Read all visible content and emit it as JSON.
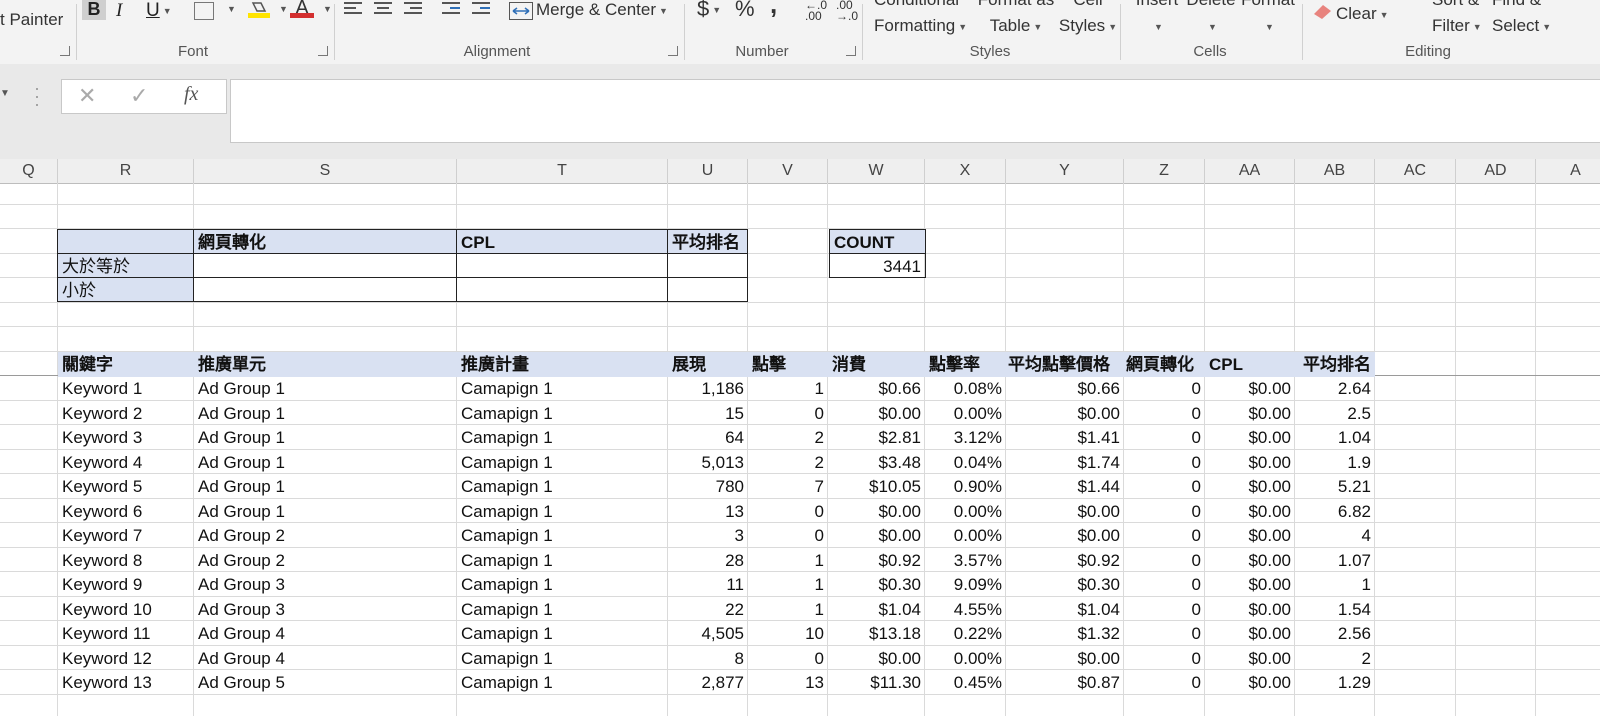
{
  "ribbon": {
    "format_painter": "t Painter",
    "merge_center": "Merge & Center",
    "currency_symbol": "$",
    "percent_symbol": "%",
    "comma_symbol": ",",
    "conditional_1": "Conditional",
    "conditional_2": "Formatting",
    "format_as_1": "Format as",
    "format_as_2": "Table",
    "cell_styles_1": "Cell",
    "cell_styles_2": "Styles",
    "insert": "Insert",
    "delete": "Delete",
    "format": "Format",
    "clear": "Clear",
    "sort_filter_1": "Sort &",
    "sort_filter_2": "Filter",
    "find_select_1": "Find &",
    "find_select_2": "Select",
    "groups": {
      "font": "Font",
      "alignment": "Alignment",
      "number": "Number",
      "styles": "Styles",
      "cells": "Cells",
      "editing": "Editing"
    },
    "colors": {
      "highlight": "#ffe400",
      "font_color": "#d32f2f",
      "clear_eraser": "#e8837e"
    }
  },
  "formula_bar": {
    "value": "",
    "fx_label": "fx"
  },
  "columns": [
    "Q",
    "R",
    "S",
    "T",
    "U",
    "V",
    "W",
    "X",
    "Y",
    "Z",
    "AA",
    "AB",
    "AC",
    "AD",
    "A"
  ],
  "criteria_table": {
    "headers": [
      "",
      "網頁轉化",
      "CPL",
      "平均排名"
    ],
    "rows": [
      {
        "label": "大於等於",
        "values": [
          "",
          "",
          ""
        ]
      },
      {
        "label": "小於",
        "values": [
          "",
          "",
          ""
        ]
      }
    ]
  },
  "count_box": {
    "label": "COUNT",
    "value": "3441"
  },
  "data_table": {
    "headers": [
      "關鍵字",
      "推廣單元",
      "推廣計畫",
      "展現",
      "點擊",
      "消費",
      "點擊率",
      "平均點擊價格",
      "網頁轉化",
      "CPL",
      "平均排名"
    ],
    "rows": [
      [
        "Keyword 1",
        "Ad Group 1",
        "Camapign 1",
        "1,186",
        "1",
        "$0.66",
        "0.08%",
        "$0.66",
        "0",
        "$0.00",
        "2.64"
      ],
      [
        "Keyword 2",
        "Ad Group 1",
        "Camapign 1",
        "15",
        "0",
        "$0.00",
        "0.00%",
        "$0.00",
        "0",
        "$0.00",
        "2.5"
      ],
      [
        "Keyword 3",
        "Ad Group 1",
        "Camapign 1",
        "64",
        "2",
        "$2.81",
        "3.12%",
        "$1.41",
        "0",
        "$0.00",
        "1.04"
      ],
      [
        "Keyword 4",
        "Ad Group 1",
        "Camapign 1",
        "5,013",
        "2",
        "$3.48",
        "0.04%",
        "$1.74",
        "0",
        "$0.00",
        "1.9"
      ],
      [
        "Keyword 5",
        "Ad Group 1",
        "Camapign 1",
        "780",
        "7",
        "$10.05",
        "0.90%",
        "$1.44",
        "0",
        "$0.00",
        "5.21"
      ],
      [
        "Keyword 6",
        "Ad Group 1",
        "Camapign 1",
        "13",
        "0",
        "$0.00",
        "0.00%",
        "$0.00",
        "0",
        "$0.00",
        "6.82"
      ],
      [
        "Keyword 7",
        "Ad Group 2",
        "Camapign 1",
        "3",
        "0",
        "$0.00",
        "0.00%",
        "$0.00",
        "0",
        "$0.00",
        "4"
      ],
      [
        "Keyword 8",
        "Ad Group 2",
        "Camapign 1",
        "28",
        "1",
        "$0.92",
        "3.57%",
        "$0.92",
        "0",
        "$0.00",
        "1.07"
      ],
      [
        "Keyword 9",
        "Ad Group 3",
        "Camapign 1",
        "11",
        "1",
        "$0.30",
        "9.09%",
        "$0.30",
        "0",
        "$0.00",
        "1"
      ],
      [
        "Keyword 10",
        "Ad Group 3",
        "Camapign 1",
        "22",
        "1",
        "$1.04",
        "4.55%",
        "$1.04",
        "0",
        "$0.00",
        "1.54"
      ],
      [
        "Keyword 11",
        "Ad Group 4",
        "Camapign 1",
        "4,505",
        "10",
        "$13.18",
        "0.22%",
        "$1.32",
        "0",
        "$0.00",
        "2.56"
      ],
      [
        "Keyword 12",
        "Ad Group 4",
        "Camapign 1",
        "8",
        "0",
        "$0.00",
        "0.00%",
        "$0.00",
        "0",
        "$0.00",
        "2"
      ],
      [
        "Keyword 13",
        "Ad Group 5",
        "Camapign 1",
        "2,877",
        "13",
        "$11.30",
        "0.45%",
        "$0.87",
        "0",
        "$0.00",
        "1.29"
      ]
    ]
  },
  "colors": {
    "header_fill": "#d9e1f2",
    "gridline": "#dadada"
  }
}
